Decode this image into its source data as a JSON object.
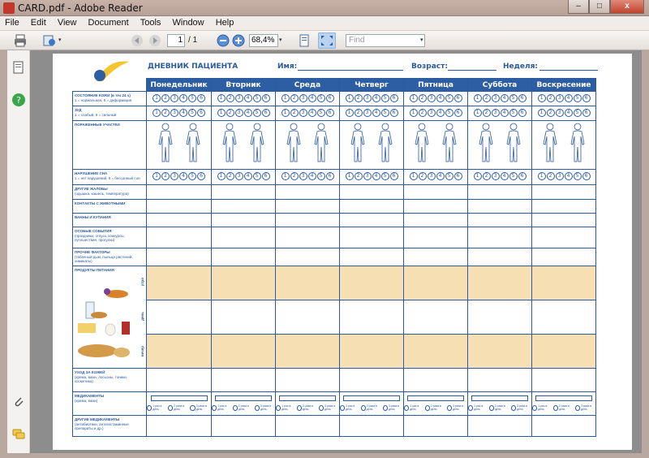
{
  "window": {
    "title": "CARD.pdf - Adobe Reader",
    "minimize": "–",
    "maximize": "□",
    "close": "x"
  },
  "menu": [
    "File",
    "Edit",
    "View",
    "Document",
    "Tools",
    "Window",
    "Help"
  ],
  "toolbar": {
    "current_page": "1",
    "page_total": "/ 1",
    "zoom": "68,4%",
    "find_placeholder": "Find"
  },
  "document": {
    "title": "ДНЕВНИК ПАЦИЕНТА",
    "name_label": "Имя:",
    "age_label": "Возраст:",
    "week_label": "Неделя:",
    "days": [
      "Понедельник",
      "Вторник",
      "Среда",
      "Четверг",
      "Пятница",
      "Суббота",
      "Воскресение"
    ],
    "scale_values": [
      "1",
      "2",
      "3",
      "4",
      "5",
      "6"
    ],
    "rows": {
      "skin": {
        "label": "СОСТОЯНИЕ КОЖИ (в теч 24 ч)",
        "note": "1 = нормальная, 6 = деформация"
      },
      "itch": {
        "label": "ЗУД",
        "note": "1 = слабый, 6 = сильный"
      },
      "affected": {
        "label": "ПОРАЖЕННЫЕ УЧАСТКИ"
      },
      "sleep": {
        "label": "НАРУШЕНИЕ СНА",
        "note": "1 = нет нарушений, 6 = бессонный сон"
      },
      "other": {
        "label": "ДРУГИЕ ЖАЛОБЫ",
        "note": "(одышка, кашель, температура)"
      },
      "animals": {
        "label": "КОНТАКТЫ С ЖИВОТНЫМИ"
      },
      "baths": {
        "label": "ВАННЫ И КУПАНИЯ"
      },
      "events": {
        "label": "ОСОБЫЕ СОБЫТИЯ",
        "note": "(праздники, отпуск, конкурсы, путешествия, прогулки)"
      },
      "factors": {
        "label": "ПРОЧИЕ ФАКТОРЫ",
        "note": "(табачный дым, пыльца растений, химикаты)"
      },
      "food": {
        "label": "ПРОДУКТЫ ПИТАНИЯ"
      },
      "care": {
        "label": "УХОД ЗА КОЖЕЙ",
        "note": "(крема, мази, лосьоны, тоники, косметика)"
      },
      "meds": {
        "label": "МЕДИКАМЕНТЫ",
        "note": "(крема, мази)"
      },
      "other_meds": {
        "label": "ДРУГИЕ МЕДИКАМЕНТЫ",
        "note": "(антибиотики, антигистаминные препараты и др.)"
      }
    },
    "meals": [
      "утро",
      "день",
      "вечер"
    ],
    "med_options": [
      "1 раз в день",
      "2 раза в день",
      "3 раза в день"
    ]
  }
}
